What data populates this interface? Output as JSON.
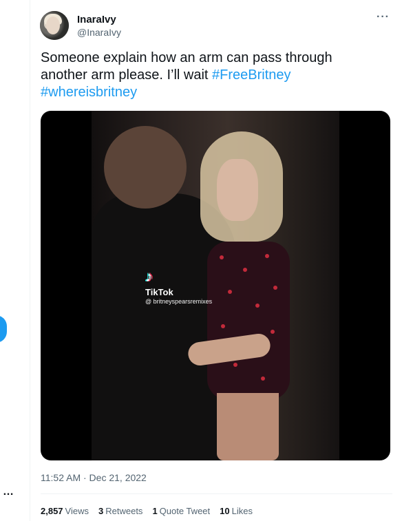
{
  "left_rail": {
    "more_label": "…",
    "accent": "#1d9bf0"
  },
  "tweet": {
    "author": {
      "display_name": "InaraIvy",
      "handle": "@InaraIvy",
      "avatar_icon": "user-avatar"
    },
    "more_label": "···",
    "text_plain": "Someone explain how an arm can pass through another arm please. I’ll wait",
    "hashtags": [
      "#FreeBritney",
      "#whereisbritney"
    ],
    "media": {
      "type": "video",
      "watermark": {
        "brand": "TikTok",
        "icon": "tiktok-icon",
        "handle": "@ britneyspearsremixes"
      }
    },
    "timestamp": "11:52 AM · Dec 21, 2022",
    "stats": [
      {
        "count": "2,857",
        "label": "Views"
      },
      {
        "count": "3",
        "label": "Retweets"
      },
      {
        "count": "1",
        "label": "Quote Tweet"
      },
      {
        "count": "10",
        "label": "Likes"
      }
    ],
    "colors": {
      "hashtag": "#1d9bf0",
      "secondary_text": "#536471",
      "primary_text": "#0f1419"
    }
  }
}
